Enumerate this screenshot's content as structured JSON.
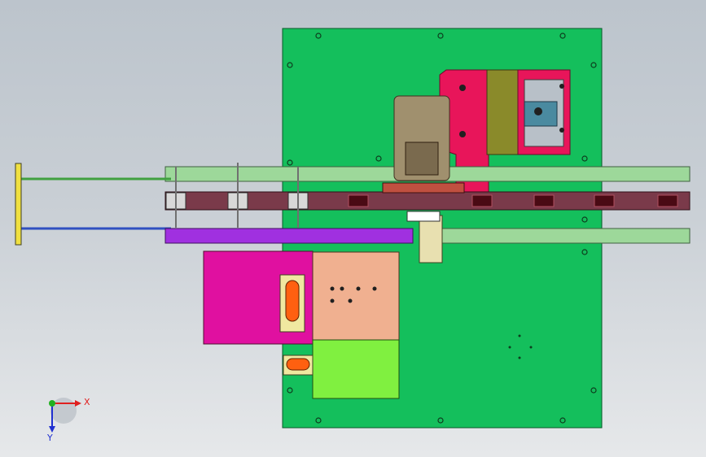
{
  "triad": {
    "x_label": "X",
    "y_label": "Y",
    "x_color": "#e02020",
    "y_color": "#2030d0",
    "z_color": "#20b020"
  },
  "colors": {
    "base_plate": "#14bf5c",
    "motor": "#a0906e",
    "bracket": "#e8155a",
    "gearbox": "#8a8a2a",
    "coupling_housing": "#4a8aa0",
    "belt_conveyor": "#7a3a4a",
    "upper_rail": "#9dd89a",
    "lower_rail": "#a030e0",
    "lower_rail_right": "#9dd89a",
    "panel_magenta": "#e010a0",
    "panel_peach": "#f0b090",
    "panel_lime": "#80f040",
    "slot_orange": "#ff6010",
    "left_stop_plate": "#f0e040",
    "shaft_green": "#40a040",
    "shaft_blue": "#3050c0",
    "pillow_block": "#e8e0b0",
    "cylinder": "#ffffff",
    "background_top": "#bcc4cc",
    "background_bottom": "#e6e8ea"
  }
}
